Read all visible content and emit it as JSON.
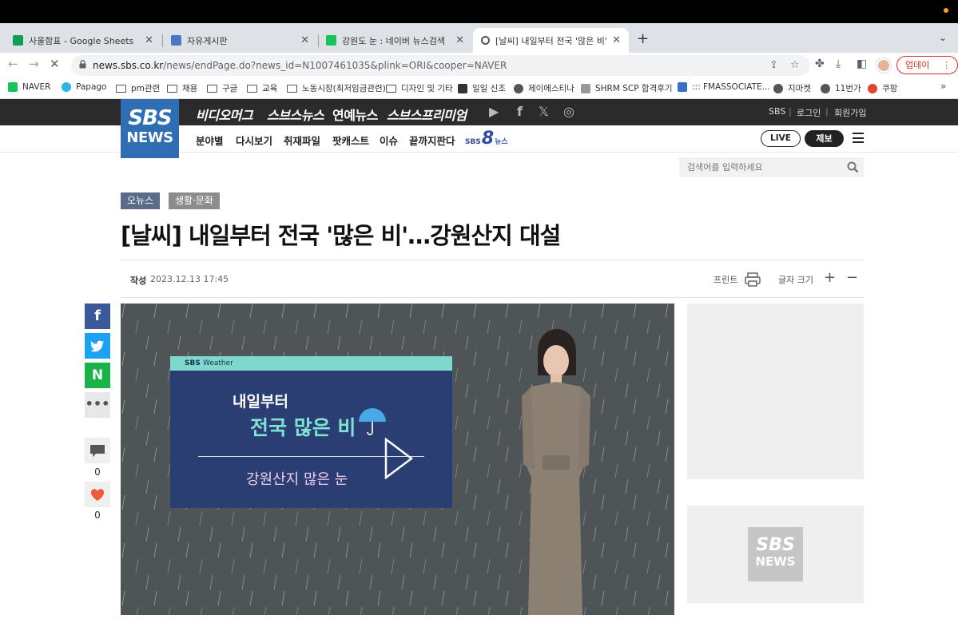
{
  "browser": {
    "tabs": [
      {
        "title": "사울함표 - Google Sheets",
        "color": "#0f9d58"
      },
      {
        "title": "자유게시판",
        "color": "#4a76c9"
      },
      {
        "title": "강원도 눈 : 네이버 뉴스검색",
        "color": "#19c35a"
      },
      {
        "title": "[날씨] 내일부터 전국 '많은 비'...강원",
        "color": "#444444"
      }
    ],
    "url_host": "news.sbs.co.kr",
    "url_path": "/news/endPage.do?news_id=N1007461035&plink=ORI&cooper=NAVER",
    "update_label": "업데이트",
    "bookmarks": [
      "NAVER",
      "Papago",
      "pm관련",
      "채용",
      "구글",
      "교육",
      "노동시장(최저임금관련)",
      "디자인 및 기타",
      "일일 신조",
      "제이에스티나",
      "SHRM SCP 합격후기",
      "::: FMASSOCIATE...",
      "지마켓",
      "11번가",
      "쿠팡"
    ]
  },
  "site": {
    "logo_top": "SBS",
    "logo_bottom": "NEWS",
    "gnb": [
      "비디오머그",
      "스브스뉴스",
      "연예뉴스",
      "스브스프리미엄"
    ],
    "util": [
      "SBS",
      "로그인",
      "회원가입"
    ],
    "lnb": [
      "분야별",
      "다시보기",
      "취재파일",
      "팟캐스트",
      "이슈",
      "끝까지판다"
    ],
    "sbs8": {
      "pre": "SBS",
      "num": "8",
      "post": "뉴스"
    },
    "live": "LIVE",
    "jebo": "제보",
    "search_placeholder": "검색어를 입력하세요"
  },
  "article": {
    "categories": [
      "오뉴스",
      "생활·문화"
    ],
    "title": "[날씨] 내일부터 전국 '많은 비'…강원산지 대설",
    "written_label": "작성",
    "date": "2023.12.13 17:45",
    "print_label": "프린트",
    "fontsize_label": "글자 크기",
    "comment_count": "0",
    "like_count": "0"
  },
  "video": {
    "board_header_brand": "SBS",
    "board_header_sub": "Weather",
    "line1": "내일부터",
    "line2": "전국 많은 비",
    "line3": "강원산지 많은 눈"
  },
  "side": {
    "logo_top": "SBS",
    "logo_bottom": "NEWS"
  },
  "colors": {
    "sbs_blue": "#2f6eb5",
    "facebook": "#3b5998",
    "twitter": "#1da1f2",
    "naver": "#19b34a",
    "category": "#8c8c8c",
    "category_primary": "#5b6b8a"
  }
}
